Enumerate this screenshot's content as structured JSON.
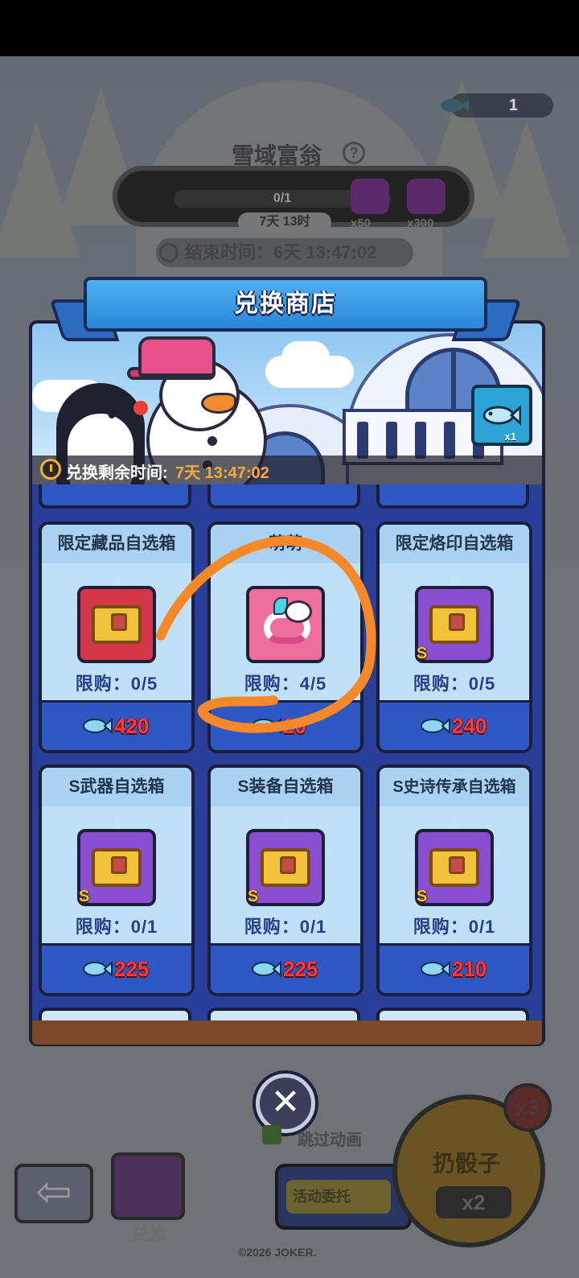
{
  "background": {
    "event_title": "雪域富翁",
    "help_icon": "question-mark-icon",
    "fish_count": "1",
    "progress_text": "0/1",
    "reward_1_qty": "x50",
    "reward_2_qty": "x300",
    "timer_pill": "7天 13时",
    "end_time_label": "结束时间：6天 13:47:02",
    "skip_animation": "跳过动画",
    "exchange_label": "兑换",
    "task_label": "活动委托",
    "roll_dice": "扔骰子",
    "roll_multiplier": "x2",
    "x3_badge": "x3",
    "copyright": "©2026 JOKER."
  },
  "modal": {
    "title": "兑换商店",
    "ticket_qty": "x1",
    "remaining_label": "兑换剩余时间:",
    "remaining_value": "7天 13:47:02",
    "close_symbol": "✕"
  },
  "items": [
    {
      "name": "限定藏品自选箱",
      "limit": "限购：0/5",
      "price": "420",
      "icon_color": "#d4374a",
      "icon": "treasure-chest-icon",
      "rank": ""
    },
    {
      "name": "萌萌",
      "limit": "限购：4/5",
      "price": "20",
      "icon_color": "#ef6f9c",
      "icon": "pet-snake-icon",
      "rank": ""
    },
    {
      "name": "限定烙印自选箱",
      "limit": "限购：0/5",
      "price": "240",
      "icon_color": "#8a4fd0",
      "icon": "skull-chest-icon",
      "rank": "S"
    },
    {
      "name": "S武器自选箱",
      "limit": "限购：0/1",
      "price": "225",
      "icon_color": "#8a4fd0",
      "icon": "shield-chest-icon",
      "rank": "S"
    },
    {
      "name": "S装备自选箱",
      "limit": "限购：0/1",
      "price": "225",
      "icon_color": "#8a4fd0",
      "icon": "helmet-chest-icon",
      "rank": "S"
    },
    {
      "name": "S史诗传承自选箱",
      "limit": "限购：0/1",
      "price": "210",
      "icon_color": "#8a4fd0",
      "icon": "star-chest-icon",
      "rank": "S"
    }
  ],
  "colors": {
    "price_red": "#ff3a3a",
    "timer_orange": "#f7a93a",
    "annotation_orange": "#f5892a"
  }
}
